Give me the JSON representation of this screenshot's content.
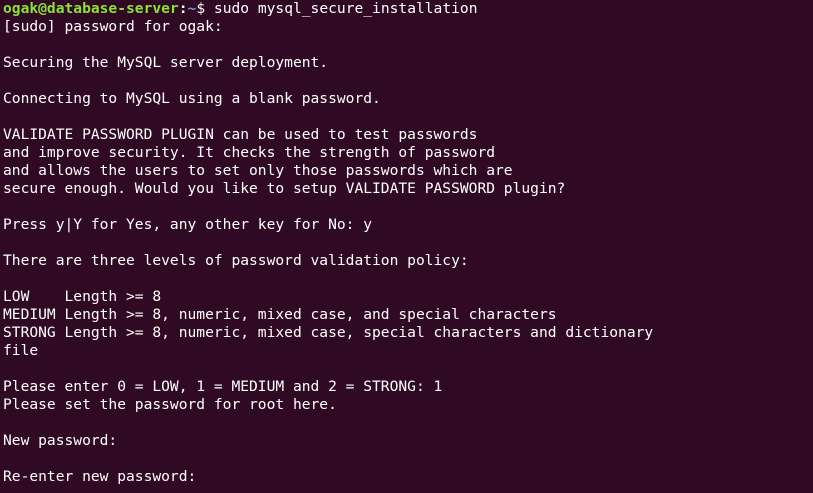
{
  "terminal": {
    "prompt": {
      "user_host": "ogak@database-server",
      "separator": ":",
      "path": "~",
      "symbol": "$ ",
      "command": "sudo mysql_secure_installation"
    },
    "lines": [
      "[sudo] password for ogak:",
      "",
      "Securing the MySQL server deployment.",
      "",
      "Connecting to MySQL using a blank password.",
      "",
      "VALIDATE PASSWORD PLUGIN can be used to test passwords",
      "and improve security. It checks the strength of password",
      "and allows the users to set only those passwords which are",
      "secure enough. Would you like to setup VALIDATE PASSWORD plugin?",
      "",
      "Press y|Y for Yes, any other key for No: y",
      "",
      "There are three levels of password validation policy:",
      "",
      "LOW    Length >= 8",
      "MEDIUM Length >= 8, numeric, mixed case, and special characters",
      "STRONG Length >= 8, numeric, mixed case, special characters and dictionary",
      "file",
      "",
      "Please enter 0 = LOW, 1 = MEDIUM and 2 = STRONG: 1",
      "Please set the password for root here.",
      "",
      "New password:",
      "",
      "Re-enter new password:"
    ],
    "colors": {
      "background": "#300a24",
      "text": "#ffffff",
      "prompt_user": "#8ae234",
      "prompt_path": "#729fcf"
    }
  }
}
